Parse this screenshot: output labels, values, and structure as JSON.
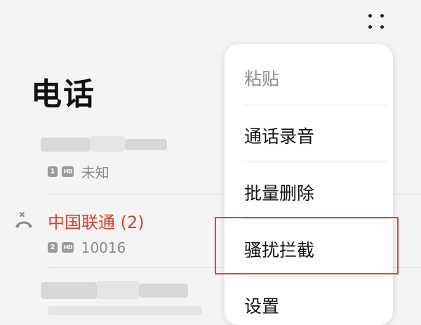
{
  "header": {
    "title": "电话",
    "more_icon": "more-dots-icon"
  },
  "calls": [
    {
      "name": "",
      "sim": "1",
      "hd": "HD",
      "location": "未知",
      "missed": false
    },
    {
      "name": "中国联通 (2)",
      "sim": "2",
      "hd": "HD",
      "number": "10016",
      "missed": true
    },
    {
      "name": "",
      "missed": false
    }
  ],
  "menu": {
    "items": [
      {
        "label": "粘贴",
        "enabled": false
      },
      {
        "label": "通话录音",
        "enabled": true
      },
      {
        "label": "批量删除",
        "enabled": true
      },
      {
        "label": "骚扰拦截",
        "enabled": true,
        "highlighted": true
      },
      {
        "label": "设置",
        "enabled": true
      }
    ]
  },
  "colors": {
    "accent_red": "#d7402b",
    "highlight_border": "#e34141",
    "background": "#f4f4f4",
    "menu_bg": "#ffffff"
  }
}
